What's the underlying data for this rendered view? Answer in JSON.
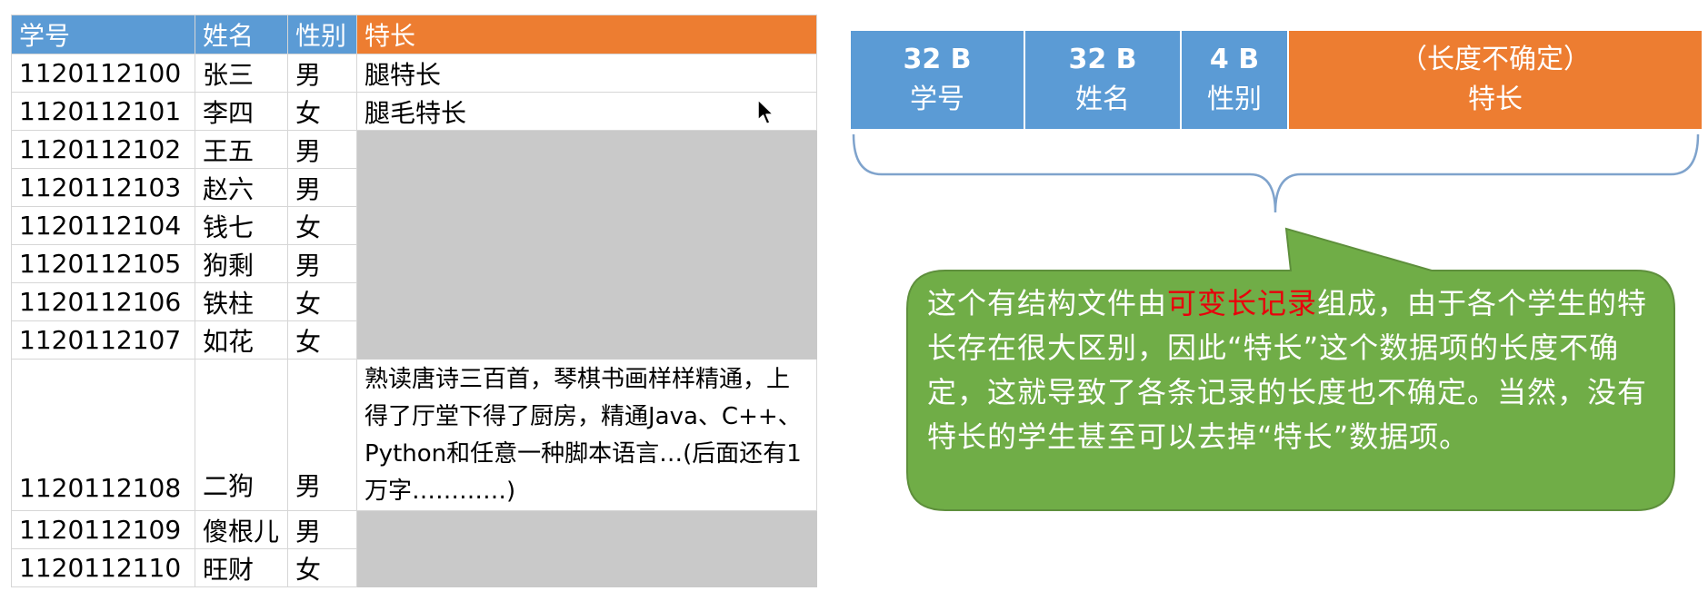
{
  "table": {
    "headers": [
      "学号",
      "姓名",
      "性别",
      "特长"
    ],
    "rows": [
      {
        "id": "1120112100",
        "name": "张三",
        "gender": "男",
        "specialty": "腿特长"
      },
      {
        "id": "1120112101",
        "name": "李四",
        "gender": "女",
        "specialty": "腿毛特长"
      },
      {
        "id": "1120112102",
        "name": "王五",
        "gender": "男",
        "specialty": ""
      },
      {
        "id": "1120112103",
        "name": "赵六",
        "gender": "男",
        "specialty": ""
      },
      {
        "id": "1120112104",
        "name": "钱七",
        "gender": "女",
        "specialty": ""
      },
      {
        "id": "1120112105",
        "name": "狗剩",
        "gender": "男",
        "specialty": ""
      },
      {
        "id": "1120112106",
        "name": "铁柱",
        "gender": "女",
        "specialty": ""
      },
      {
        "id": "1120112107",
        "name": "如花",
        "gender": "女",
        "specialty": ""
      },
      {
        "id": "1120112108",
        "name": "二狗",
        "gender": "男",
        "specialty": "熟读唐诗三百首，琴棋书画样样精通，上得了厅堂下得了厨房，精通Java、C++、Python和任意一种脚本语言…(后面还有1万字…………)"
      },
      {
        "id": "1120112109",
        "name": "傻根儿",
        "gender": "男",
        "specialty": ""
      },
      {
        "id": "1120112110",
        "name": "旺财",
        "gender": "女",
        "specialty": ""
      }
    ]
  },
  "record": {
    "fields": [
      {
        "size": "32 B",
        "label": "学号",
        "color": "#5b9bd5"
      },
      {
        "size": "32 B",
        "label": "姓名",
        "color": "#5b9bd5"
      },
      {
        "size": "4 B",
        "label": "性别",
        "color": "#5b9bd5"
      },
      {
        "size": "（长度不确定）",
        "label": "特长",
        "color": "#ed7d31"
      }
    ]
  },
  "callout": {
    "before": "这个有结构文件由",
    "highlight": "可变长记录",
    "after": "组成，由于各个学生的特长存在很大区别，因此“特长”这个数据项的长度不确定，这就导致了各条记录的长度也不确定。当然，没有特长的学生甚至可以去掉“特长”数据项。",
    "fill_color": "#70ad47",
    "highlight_color": "#e8000b"
  },
  "colors": {
    "header_blue": "#5b9bd5",
    "header_orange": "#ed7d31",
    "empty_cell_gray": "#c9c9c9"
  }
}
